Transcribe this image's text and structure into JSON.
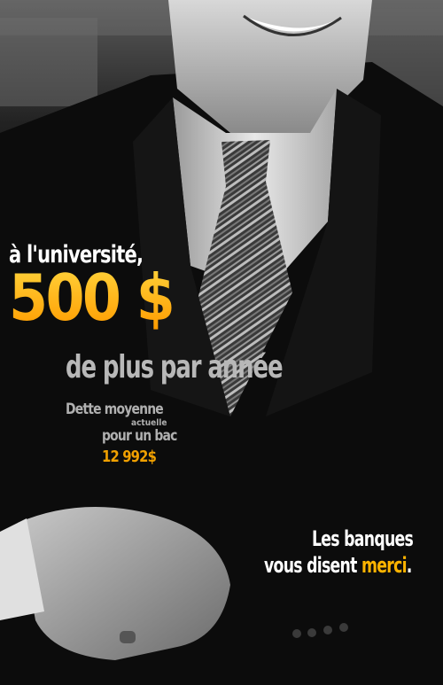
{
  "poster": {
    "line1": "à l'université,",
    "big_amount": "500 $",
    "line3": "de plus par année",
    "debt_label": "Dette moyenne",
    "debt_qualifier": "actuelle",
    "debt_degree": "pour un bac",
    "debt_amount": "12 992$",
    "slogan_line1": "Les banques",
    "slogan_line2_pre": "vous disent ",
    "slogan_highlight": "merci",
    "slogan_end": "."
  },
  "colors": {
    "accent": "#ffb400",
    "text_white": "#ffffff",
    "text_gray": "#b8b8b8",
    "background": "#000000"
  }
}
